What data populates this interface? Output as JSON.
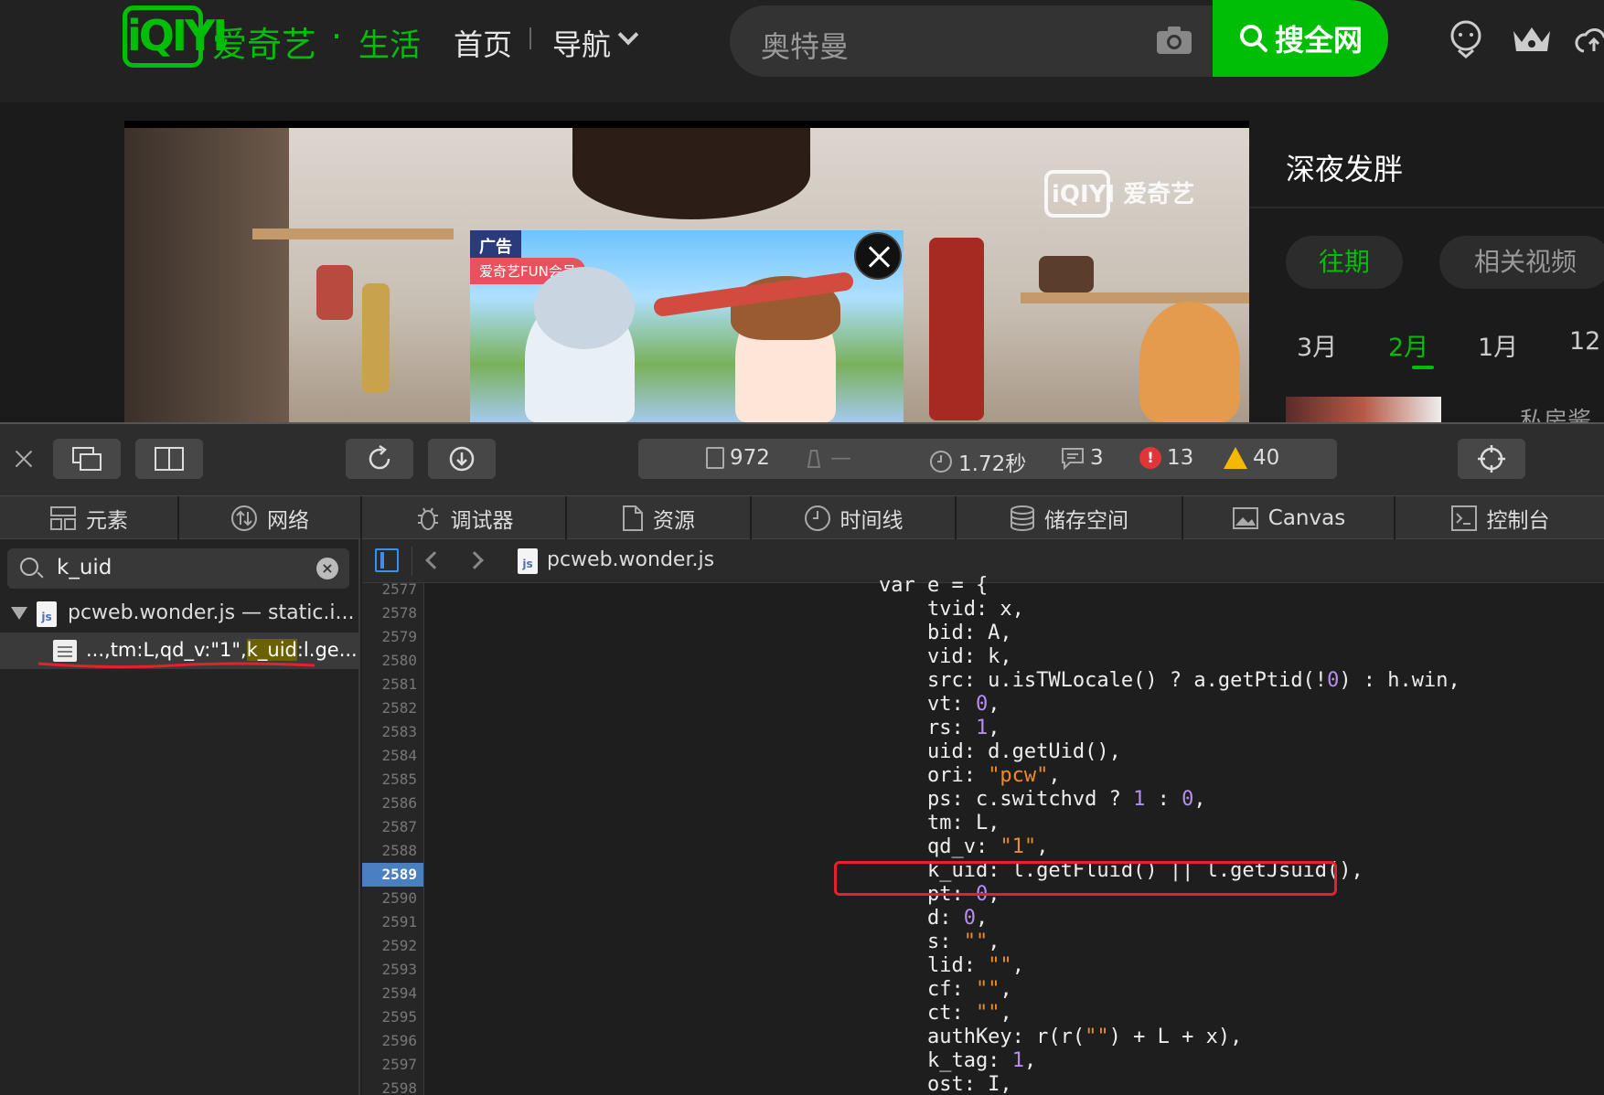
{
  "site": {
    "logo_mark": "iQIYI",
    "logo_cn": "爱奇艺",
    "logo_dot": "·",
    "logo_sub": "生活",
    "nav": {
      "home": "首页",
      "guide": "导航"
    },
    "search": {
      "placeholder": "奥特曼",
      "button": "搜全网"
    },
    "brand_color": "#00be06"
  },
  "player": {
    "watermark": "iQIYI 爱奇艺",
    "ad": {
      "tag": "广告",
      "fun": "爱奇艺FUN会员"
    }
  },
  "side_panel": {
    "title": "深夜发胖",
    "tabs": [
      {
        "label": "往期",
        "active": true
      },
      {
        "label": "相关视频",
        "active": false
      }
    ],
    "months": [
      {
        "label": "3月"
      },
      {
        "label": "2月",
        "active": true
      },
      {
        "label": "1月"
      },
      {
        "label": "12"
      }
    ],
    "thumb_title": "私房酱子"
  },
  "devtools": {
    "stats": {
      "resources": "972",
      "bytes": "—",
      "load_time": "1.72秒",
      "logs": "3",
      "errors": "13",
      "warnings": "40"
    },
    "tabs": [
      {
        "label": "元素"
      },
      {
        "label": "网络"
      },
      {
        "label": "调试器"
      },
      {
        "label": "资源"
      },
      {
        "label": "时间线"
      },
      {
        "label": "储存空间"
      },
      {
        "label": "Canvas"
      },
      {
        "label": "控制台"
      }
    ],
    "search": {
      "value": "k_uid",
      "clear": "×"
    },
    "tree": {
      "file": "pcweb.wonder.js — static.i...",
      "match_prefix": "...,tm:L,qd_v:\"1\",",
      "match_hl": "k_uid",
      "match_suffix": ":l.ge..."
    },
    "editor": {
      "file": "pcweb.wonder.js",
      "lines": [
        "2577",
        "2578",
        "2579",
        "2580",
        "2581",
        "2582",
        "2583",
        "2584",
        "2585",
        "2586",
        "2587",
        "2588",
        "2589",
        "2590",
        "2591",
        "2592",
        "2593",
        "2594",
        "2595",
        "2596",
        "2597",
        "2598"
      ],
      "active_line": "2589",
      "code": [
        "    var e = {",
        "        tvid: x,",
        "        bid: A,",
        "        vid: k,",
        "        src: u.isTWLocale() ? a.getPtid(!0) : h.win,",
        "        vt: 0,",
        "        rs: 1,",
        "        uid: d.getUid(),",
        "        ori: \"pcw\",",
        "        ps: c.switchvd ? 1 : 0,",
        "        tm: L,",
        "        qd_v: \"1\",",
        "        k_uid: l.getFluid() || l.getJsuid(),",
        "        pt: 0,",
        "        d: 0,",
        "        s: \"\",",
        "        lid: \"\",",
        "        cf: \"\",",
        "        ct: \"\",",
        "        authKey: r(r(\"\") + L + x),",
        "        k_tag: 1,",
        "        ost: I,"
      ]
    }
  }
}
